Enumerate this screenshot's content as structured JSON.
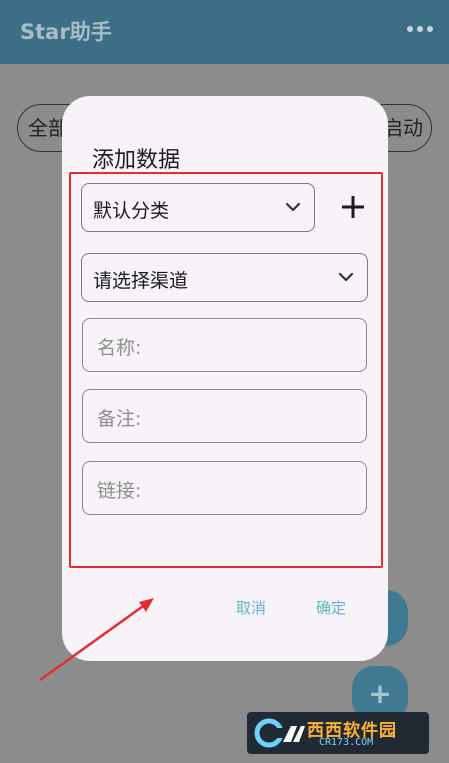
{
  "app": {
    "title": "Star助手"
  },
  "background": {
    "chip_left_label": "全部",
    "chip_right_label": "启动",
    "fab_bottom_symbol": "+"
  },
  "dialog": {
    "title": "添加数据",
    "category_value": "默认分类",
    "channel_placeholder": "请选择渠道",
    "name_placeholder": "名称:",
    "note_placeholder": "备注:",
    "link_placeholder": "链接:",
    "cancel_label": "取消",
    "confirm_label": "确定"
  },
  "watermark": {
    "text": "西西软件园",
    "sub": "CR173.COM"
  },
  "colors": {
    "app_bar": "#3c6e85",
    "dialog_bg": "#f7f3f8",
    "annotation": "#e02f2f",
    "action_text": "#5fb6c8"
  },
  "icons": {
    "more": "more-dots-icon",
    "dropdown": "chevron-down-icon",
    "add": "plus-icon",
    "annotation_arrow": "arrow-icon"
  }
}
